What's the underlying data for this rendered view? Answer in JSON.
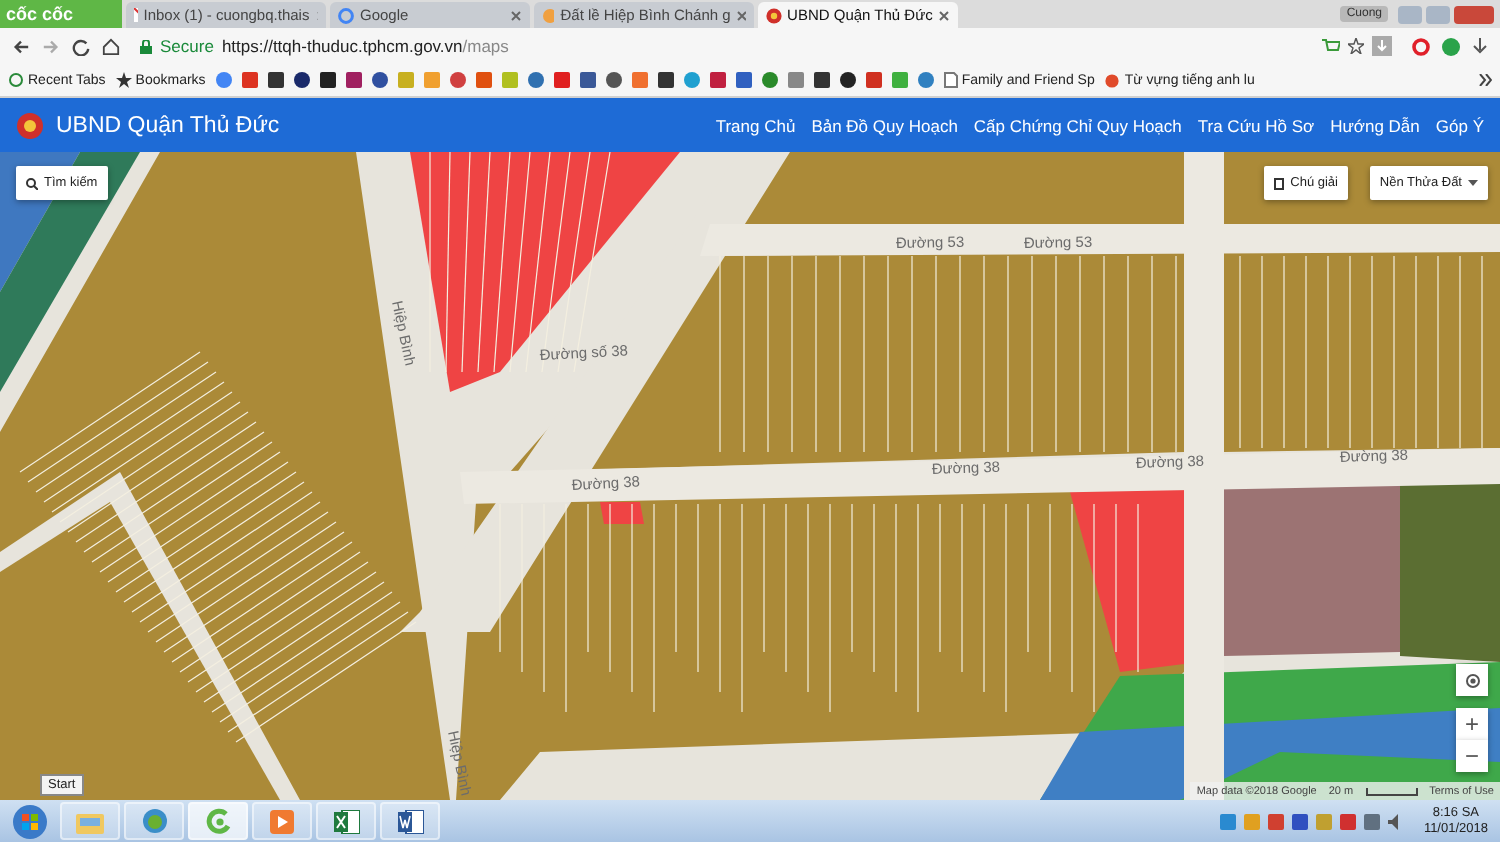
{
  "browser": {
    "logo": "cốc cốc",
    "tabs": [
      {
        "title": "Inbox (1) - cuongbq.thais",
        "selected": false
      },
      {
        "title": "Google",
        "selected": false
      },
      {
        "title": "Đất lề Hiệp Bình Chánh g",
        "selected": false
      },
      {
        "title": "UBND Quận Thủ Đức",
        "selected": true
      }
    ],
    "user": "Cuong",
    "secure_label": "Secure",
    "url_host": "https://ttqh-thuduc.tphcm.gov.vn",
    "url_path": "/maps",
    "bookmarks": [
      {
        "label": "Recent Tabs",
        "kind": "history"
      },
      {
        "label": "Bookmarks",
        "kind": "star"
      },
      {
        "label": "Family and Friend Sp",
        "kind": "page"
      },
      {
        "label": "Từ vựng tiếng anh lu",
        "kind": "fruit"
      }
    ]
  },
  "site": {
    "title": "UBND Quận Thủ Đức",
    "nav": [
      "Trang Chủ",
      "Bản Đồ Quy Hoạch",
      "Cấp Chứng Chỉ Quy Hoạch",
      "Tra Cứu Hồ Sơ",
      "Hướng Dẫn",
      "Góp Ý"
    ]
  },
  "map": {
    "search_button": "Tìm kiếm",
    "legend_button": "Chú giải",
    "layer_select": "Nền Thửa Đất",
    "streets": [
      "Hiệp Bình",
      "Hiệp Bình",
      "Đường 53",
      "Đường 53",
      "Đường số 38",
      "Đường 38",
      "Đường 38",
      "Đường 38",
      "Đường 38"
    ],
    "zoom_in": "+",
    "zoom_out": "−",
    "attribution": "Map data ©2018 Google",
    "scale": "20 m",
    "terms": "Terms of Use"
  },
  "taskbar": {
    "tooltip": "Start",
    "apps": [
      {
        "kind": "explorer",
        "selected": false
      },
      {
        "kind": "parrot",
        "selected": false
      },
      {
        "kind": "coccoc",
        "selected": true
      },
      {
        "kind": "media",
        "selected": false
      },
      {
        "kind": "excel",
        "selected": false
      },
      {
        "kind": "word",
        "selected": false
      }
    ],
    "time": "8:16 SA",
    "date": "11/01/2018"
  }
}
